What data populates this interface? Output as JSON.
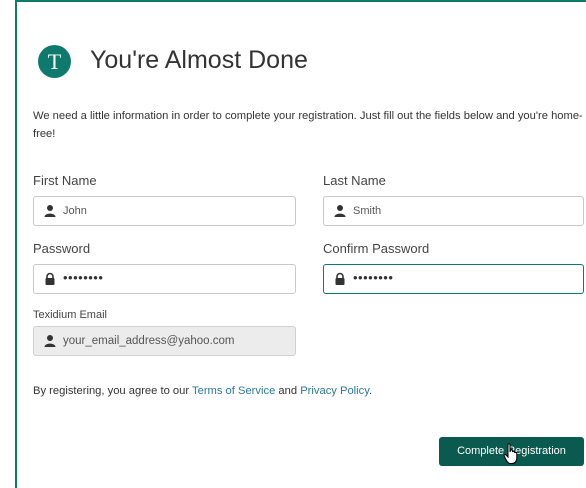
{
  "header": {
    "logo_letter": "T",
    "title": "You're Almost Done"
  },
  "intro_text": "We need a little information in order to complete your registration. Just fill out the fields below and you're home-free!",
  "form": {
    "first_name": {
      "label": "First Name",
      "value": "John",
      "icon": "user-icon"
    },
    "last_name": {
      "label": "Last Name",
      "value": "Smith",
      "icon": "user-icon"
    },
    "password": {
      "label": "Password",
      "value": "••••••••",
      "icon": "lock-icon"
    },
    "confirm_password": {
      "label": "Confirm Password",
      "value": "••••••••",
      "icon": "lock-icon"
    },
    "email": {
      "label": "Texidium Email",
      "value": "your_email_address@yahoo.com",
      "icon": "user-icon"
    }
  },
  "terms": {
    "prefix": "By registering, you agree to our ",
    "terms_link": "Terms of Service",
    "middle": " and ",
    "privacy_link": "Privacy Policy",
    "suffix": "."
  },
  "submit_label": "Complete Registration",
  "colors": {
    "accent": "#0e7a6e",
    "button": "#0a5a4f",
    "link": "#2a7a98"
  }
}
